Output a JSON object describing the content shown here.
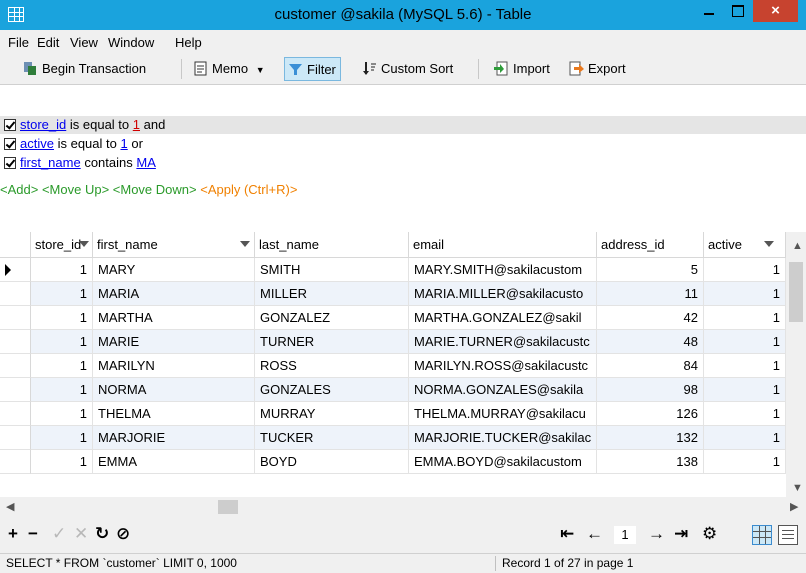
{
  "window": {
    "title": "customer @sakila (MySQL 5.6) - Table",
    "close": "×"
  },
  "menu": [
    "File",
    "Edit",
    "View",
    "Window",
    "Help"
  ],
  "toolbar": {
    "begin_transaction": "Begin Transaction",
    "memo": "Memo",
    "filter": "Filter",
    "custom_sort": "Custom Sort",
    "import": "Import",
    "export": "Export"
  },
  "filter": {
    "conditions": [
      {
        "field": "store_id",
        "op": "is equal to",
        "value": "1",
        "join": "and"
      },
      {
        "field": "active",
        "op": "is equal to",
        "value": "1",
        "join": "or"
      },
      {
        "field": "first_name",
        "op": "contains",
        "value": "MA",
        "join": ""
      }
    ],
    "actions": {
      "add": "<Add>",
      "move_up": "<Move Up>",
      "move_down": "<Move Down>",
      "apply": "<Apply (Ctrl+R)>"
    }
  },
  "grid": {
    "columns": [
      "store_id",
      "first_name",
      "last_name",
      "email",
      "address_id",
      "active"
    ],
    "rows": [
      [
        "1",
        "MARY",
        "SMITH",
        "MARY.SMITH@sakilacustom",
        "5",
        "1"
      ],
      [
        "1",
        "MARIA",
        "MILLER",
        "MARIA.MILLER@sakilacusto",
        "11",
        "1"
      ],
      [
        "1",
        "MARTHA",
        "GONZALEZ",
        "MARTHA.GONZALEZ@sakil",
        "42",
        "1"
      ],
      [
        "1",
        "MARIE",
        "TURNER",
        "MARIE.TURNER@sakilacustc",
        "48",
        "1"
      ],
      [
        "1",
        "MARILYN",
        "ROSS",
        "MARILYN.ROSS@sakilacustc",
        "84",
        "1"
      ],
      [
        "1",
        "NORMA",
        "GONZALES",
        "NORMA.GONZALES@sakila",
        "98",
        "1"
      ],
      [
        "1",
        "THELMA",
        "MURRAY",
        "THELMA.MURRAY@sakilacu",
        "126",
        "1"
      ],
      [
        "1",
        "MARJORIE",
        "TUCKER",
        "MARJORIE.TUCKER@sakilac",
        "132",
        "1"
      ],
      [
        "1",
        "EMMA",
        "BOYD",
        "EMMA.BOYD@sakilacustom",
        "138",
        "1"
      ]
    ]
  },
  "nav": {
    "page": "1"
  },
  "status": {
    "sql": "SELECT * FROM `customer` LIMIT 0, 1000",
    "record": "Record 1 of 27 in page 1"
  }
}
